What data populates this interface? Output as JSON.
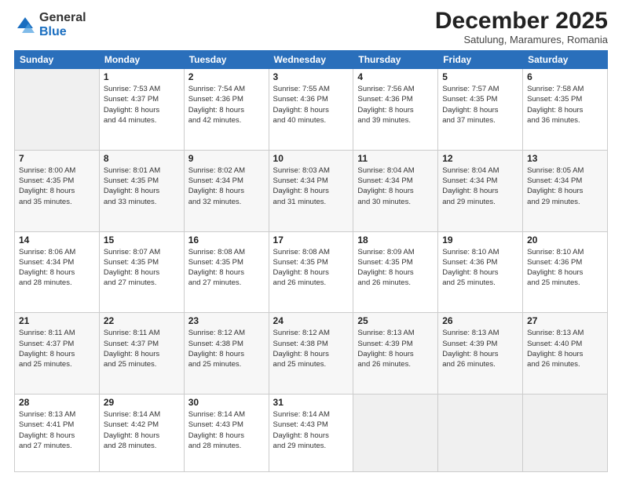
{
  "logo": {
    "general": "General",
    "blue": "Blue"
  },
  "title": "December 2025",
  "subtitle": "Satulung, Maramures, Romania",
  "days_header": [
    "Sunday",
    "Monday",
    "Tuesday",
    "Wednesday",
    "Thursday",
    "Friday",
    "Saturday"
  ],
  "weeks": [
    [
      {
        "day": "",
        "info": ""
      },
      {
        "day": "1",
        "info": "Sunrise: 7:53 AM\nSunset: 4:37 PM\nDaylight: 8 hours\nand 44 minutes."
      },
      {
        "day": "2",
        "info": "Sunrise: 7:54 AM\nSunset: 4:36 PM\nDaylight: 8 hours\nand 42 minutes."
      },
      {
        "day": "3",
        "info": "Sunrise: 7:55 AM\nSunset: 4:36 PM\nDaylight: 8 hours\nand 40 minutes."
      },
      {
        "day": "4",
        "info": "Sunrise: 7:56 AM\nSunset: 4:36 PM\nDaylight: 8 hours\nand 39 minutes."
      },
      {
        "day": "5",
        "info": "Sunrise: 7:57 AM\nSunset: 4:35 PM\nDaylight: 8 hours\nand 37 minutes."
      },
      {
        "day": "6",
        "info": "Sunrise: 7:58 AM\nSunset: 4:35 PM\nDaylight: 8 hours\nand 36 minutes."
      }
    ],
    [
      {
        "day": "7",
        "info": "Sunrise: 8:00 AM\nSunset: 4:35 PM\nDaylight: 8 hours\nand 35 minutes."
      },
      {
        "day": "8",
        "info": "Sunrise: 8:01 AM\nSunset: 4:35 PM\nDaylight: 8 hours\nand 33 minutes."
      },
      {
        "day": "9",
        "info": "Sunrise: 8:02 AM\nSunset: 4:34 PM\nDaylight: 8 hours\nand 32 minutes."
      },
      {
        "day": "10",
        "info": "Sunrise: 8:03 AM\nSunset: 4:34 PM\nDaylight: 8 hours\nand 31 minutes."
      },
      {
        "day": "11",
        "info": "Sunrise: 8:04 AM\nSunset: 4:34 PM\nDaylight: 8 hours\nand 30 minutes."
      },
      {
        "day": "12",
        "info": "Sunrise: 8:04 AM\nSunset: 4:34 PM\nDaylight: 8 hours\nand 29 minutes."
      },
      {
        "day": "13",
        "info": "Sunrise: 8:05 AM\nSunset: 4:34 PM\nDaylight: 8 hours\nand 29 minutes."
      }
    ],
    [
      {
        "day": "14",
        "info": "Sunrise: 8:06 AM\nSunset: 4:34 PM\nDaylight: 8 hours\nand 28 minutes."
      },
      {
        "day": "15",
        "info": "Sunrise: 8:07 AM\nSunset: 4:35 PM\nDaylight: 8 hours\nand 27 minutes."
      },
      {
        "day": "16",
        "info": "Sunrise: 8:08 AM\nSunset: 4:35 PM\nDaylight: 8 hours\nand 27 minutes."
      },
      {
        "day": "17",
        "info": "Sunrise: 8:08 AM\nSunset: 4:35 PM\nDaylight: 8 hours\nand 26 minutes."
      },
      {
        "day": "18",
        "info": "Sunrise: 8:09 AM\nSunset: 4:35 PM\nDaylight: 8 hours\nand 26 minutes."
      },
      {
        "day": "19",
        "info": "Sunrise: 8:10 AM\nSunset: 4:36 PM\nDaylight: 8 hours\nand 25 minutes."
      },
      {
        "day": "20",
        "info": "Sunrise: 8:10 AM\nSunset: 4:36 PM\nDaylight: 8 hours\nand 25 minutes."
      }
    ],
    [
      {
        "day": "21",
        "info": "Sunrise: 8:11 AM\nSunset: 4:37 PM\nDaylight: 8 hours\nand 25 minutes."
      },
      {
        "day": "22",
        "info": "Sunrise: 8:11 AM\nSunset: 4:37 PM\nDaylight: 8 hours\nand 25 minutes."
      },
      {
        "day": "23",
        "info": "Sunrise: 8:12 AM\nSunset: 4:38 PM\nDaylight: 8 hours\nand 25 minutes."
      },
      {
        "day": "24",
        "info": "Sunrise: 8:12 AM\nSunset: 4:38 PM\nDaylight: 8 hours\nand 25 minutes."
      },
      {
        "day": "25",
        "info": "Sunrise: 8:13 AM\nSunset: 4:39 PM\nDaylight: 8 hours\nand 26 minutes."
      },
      {
        "day": "26",
        "info": "Sunrise: 8:13 AM\nSunset: 4:39 PM\nDaylight: 8 hours\nand 26 minutes."
      },
      {
        "day": "27",
        "info": "Sunrise: 8:13 AM\nSunset: 4:40 PM\nDaylight: 8 hours\nand 26 minutes."
      }
    ],
    [
      {
        "day": "28",
        "info": "Sunrise: 8:13 AM\nSunset: 4:41 PM\nDaylight: 8 hours\nand 27 minutes."
      },
      {
        "day": "29",
        "info": "Sunrise: 8:14 AM\nSunset: 4:42 PM\nDaylight: 8 hours\nand 28 minutes."
      },
      {
        "day": "30",
        "info": "Sunrise: 8:14 AM\nSunset: 4:43 PM\nDaylight: 8 hours\nand 28 minutes."
      },
      {
        "day": "31",
        "info": "Sunrise: 8:14 AM\nSunset: 4:43 PM\nDaylight: 8 hours\nand 29 minutes."
      },
      {
        "day": "",
        "info": ""
      },
      {
        "day": "",
        "info": ""
      },
      {
        "day": "",
        "info": ""
      }
    ]
  ]
}
